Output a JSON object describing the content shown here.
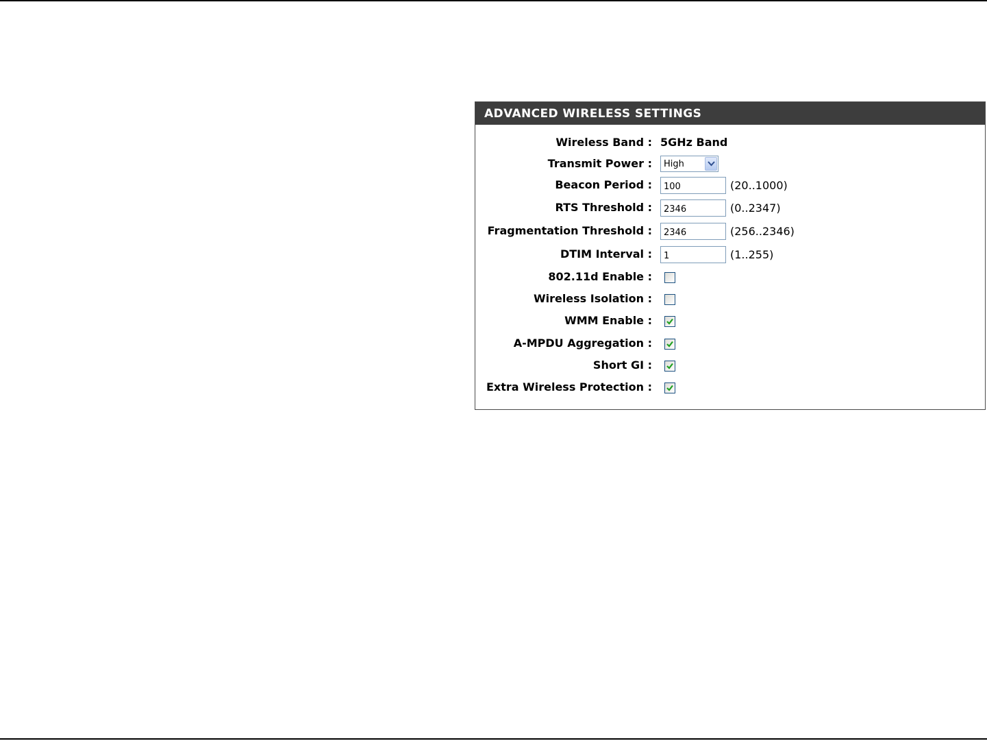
{
  "panel": {
    "title": "ADVANCED WIRELESS SETTINGS"
  },
  "fields": {
    "wireless_band": {
      "label": "Wireless Band :",
      "value": "5GHz Band"
    },
    "transmit_power": {
      "label": "Transmit Power :",
      "value": "High"
    },
    "beacon_period": {
      "label": "Beacon Period :",
      "value": "100",
      "range": "(20..1000)"
    },
    "rts_threshold": {
      "label": "RTS Threshold :",
      "value": "2346",
      "range": "(0..2347)"
    },
    "fragmentation_threshold": {
      "label": "Fragmentation Threshold :",
      "value": "2346",
      "range": "(256..2346)"
    },
    "dtim_interval": {
      "label": "DTIM Interval :",
      "value": "1",
      "range": "(1..255)"
    },
    "enable_80211d": {
      "label": "802.11d Enable :",
      "checked": false
    },
    "wireless_isolation": {
      "label": "Wireless Isolation :",
      "checked": false
    },
    "wmm_enable": {
      "label": "WMM Enable :",
      "checked": true
    },
    "ampdu_aggregation": {
      "label": "A-MPDU Aggregation :",
      "checked": true
    },
    "short_gi": {
      "label": "Short GI :",
      "checked": true
    },
    "extra_wireless_protection": {
      "label": "Extra Wireless Protection :",
      "checked": true
    }
  },
  "colors": {
    "header_bg": "#3d3d3d",
    "checkmark": "#21a121"
  }
}
